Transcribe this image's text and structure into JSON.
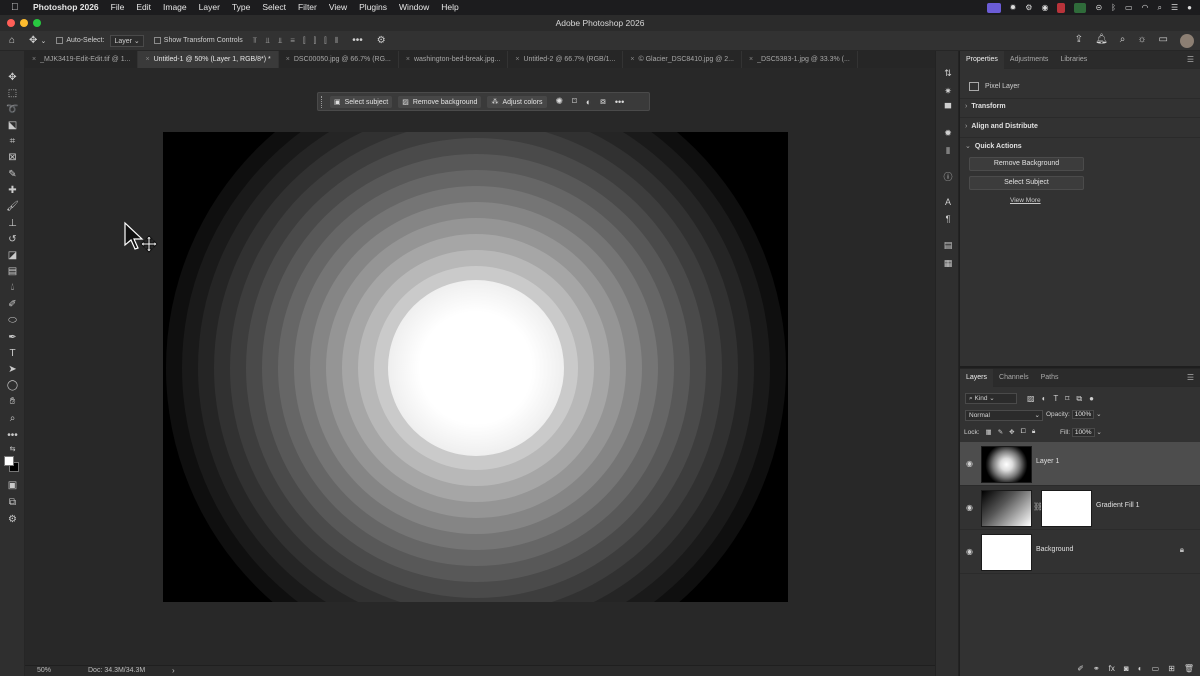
{
  "menubar": {
    "app_name": "Photoshop 2026",
    "items": [
      "File",
      "Edit",
      "Image",
      "Layer",
      "Type",
      "Select",
      "Filter",
      "View",
      "Plugins",
      "Window",
      "Help"
    ]
  },
  "window": {
    "title": "Adobe Photoshop 2026"
  },
  "options_bar": {
    "auto_select_label": "Auto-Select:",
    "auto_select_value": "Layer",
    "show_transform_label": "Show Transform Controls"
  },
  "tabs": [
    {
      "label": "_MJK3419-Edit-Edit.tif @ 1...",
      "active": false
    },
    {
      "label": "Untitled-1 @ 50% (Layer 1, RGB/8*) *",
      "active": true
    },
    {
      "label": "DSC00050.jpg @ 66.7% (RG...",
      "active": false
    },
    {
      "label": "washington-bed-break.jpg...",
      "active": false
    },
    {
      "label": "Untitled-2 @ 66.7% (RGB/1...",
      "active": false
    },
    {
      "label": "© Glacier_DSC8410.jpg @ 2...",
      "active": false
    },
    {
      "label": "_DSC5383-1.jpg @ 33.3% (...",
      "active": false
    }
  ],
  "taskbar": {
    "select_subject": "Select subject",
    "remove_background": "Remove background",
    "adjust_colors": "Adjust colors"
  },
  "statusbar": {
    "zoom": "50%",
    "doc": "Doc: 34.3M/34.3M",
    "arrow": "›"
  },
  "properties": {
    "tabs": [
      "Properties",
      "Adjustments",
      "Libraries"
    ],
    "layer_type": "Pixel Layer",
    "sections": {
      "transform": "Transform",
      "align": "Align and Distribute",
      "quick_actions": "Quick Actions"
    },
    "buttons": {
      "remove_background": "Remove Background",
      "select_subject": "Select Subject"
    },
    "view_more": "View More"
  },
  "layers_panel": {
    "tabs": [
      "Layers",
      "Channels",
      "Paths"
    ],
    "filter_kind": "Kind",
    "blend_mode": "Normal",
    "opacity_label": "Opacity:",
    "opacity_value": "100%",
    "lock_label": "Lock:",
    "fill_label": "Fill:",
    "fill_value": "100%",
    "layers": [
      {
        "name": "Layer 1",
        "selected": true
      },
      {
        "name": "Gradient Fill 1",
        "selected": false
      },
      {
        "name": "Background",
        "selected": false
      }
    ]
  },
  "colors": {
    "selected_layer_bg": "#4d4d4d",
    "panel_bg": "#323232",
    "canvas_bg": "#282828"
  }
}
